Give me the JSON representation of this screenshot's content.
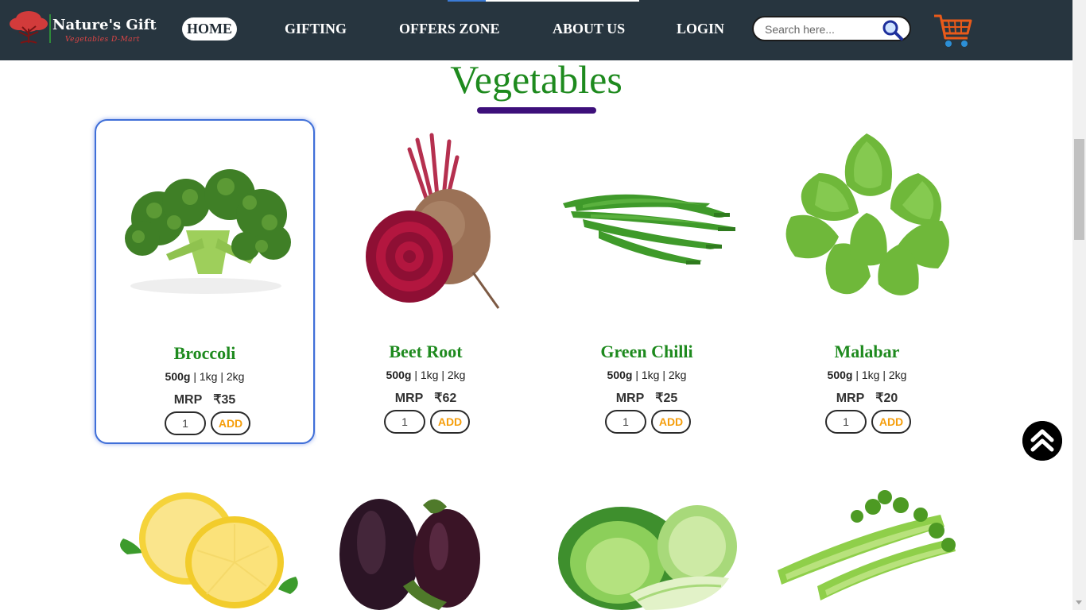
{
  "brand": {
    "title": "Nature's Gift",
    "subtitle": "Vegetables D-Mart"
  },
  "nav": {
    "home": "HOME",
    "gifting": "GIFTING",
    "offers": "OFFERS ZONE",
    "about": "ABOUT US",
    "login": "LOGIN"
  },
  "search": {
    "placeholder": "Search here..."
  },
  "section": {
    "title": "Vegetables"
  },
  "products": [
    {
      "name": "Broccoli",
      "w1": "500g",
      "wrest": " | 1kg | 2kg",
      "mrp": "MRP",
      "price": "₹35",
      "qty": "1",
      "add": "ADD"
    },
    {
      "name": "Beet Root",
      "w1": "500g",
      "wrest": " | 1kg | 2kg",
      "mrp": "MRP",
      "price": "₹62",
      "qty": "1",
      "add": "ADD"
    },
    {
      "name": "Green Chilli",
      "w1": "500g",
      "wrest": " | 1kg | 2kg",
      "mrp": "MRP",
      "price": "₹25",
      "qty": "1",
      "add": "ADD"
    },
    {
      "name": "Malabar",
      "w1": "500g",
      "wrest": " | 1kg | 2kg",
      "mrp": "MRP",
      "price": "₹20",
      "qty": "1",
      "add": "ADD"
    }
  ],
  "colors": {
    "navbar": "#27353f",
    "heading": "#1e8a1e",
    "underline": "#3d0f7a",
    "add_text": "#f59e0b",
    "card_highlight": "#3f6fd8"
  },
  "icons": {
    "logo": "tree-logo-icon",
    "search": "search-icon",
    "cart": "cart-icon",
    "scroll_top": "double-chevron-up-icon"
  }
}
